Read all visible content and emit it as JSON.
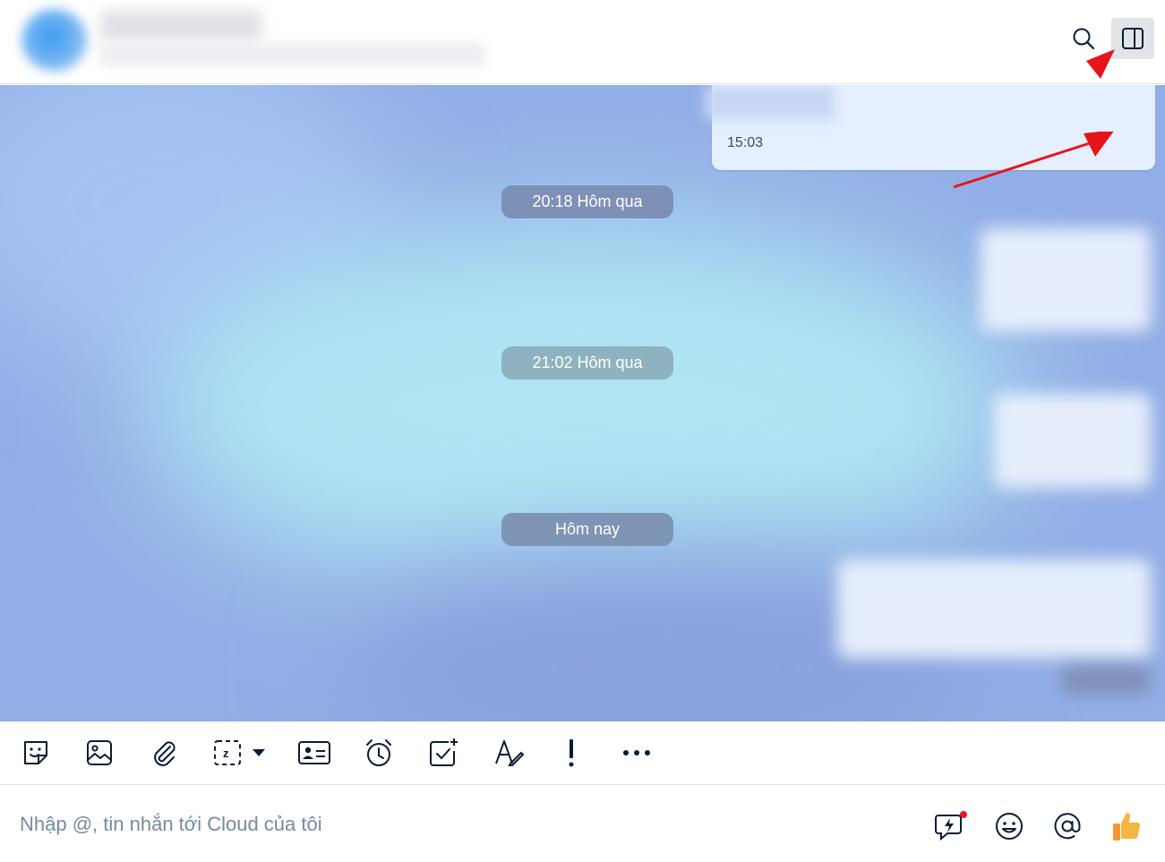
{
  "header": {
    "search_icon": "search-icon",
    "panel_icon": "sidebar-toggle-icon"
  },
  "chat": {
    "top_message_time": "15:03",
    "date_separators": [
      "20:18 Hôm qua",
      "21:02 Hôm qua",
      "Hôm nay"
    ]
  },
  "toolbar": {
    "icons": [
      "sticker-icon",
      "image-icon",
      "attachment-icon",
      "screenshot-icon",
      "contact-card-icon",
      "reminder-clock-icon",
      "task-check-icon",
      "text-format-icon",
      "important-mark-icon",
      "more-icon"
    ]
  },
  "composer": {
    "placeholder": "Nhập @, tin nhắn tới Cloud của tôi",
    "value": ""
  },
  "colors": {
    "accent_arrow": "#e8141b",
    "pill_bg": "#7d91b7",
    "icon_color": "#081c36"
  }
}
